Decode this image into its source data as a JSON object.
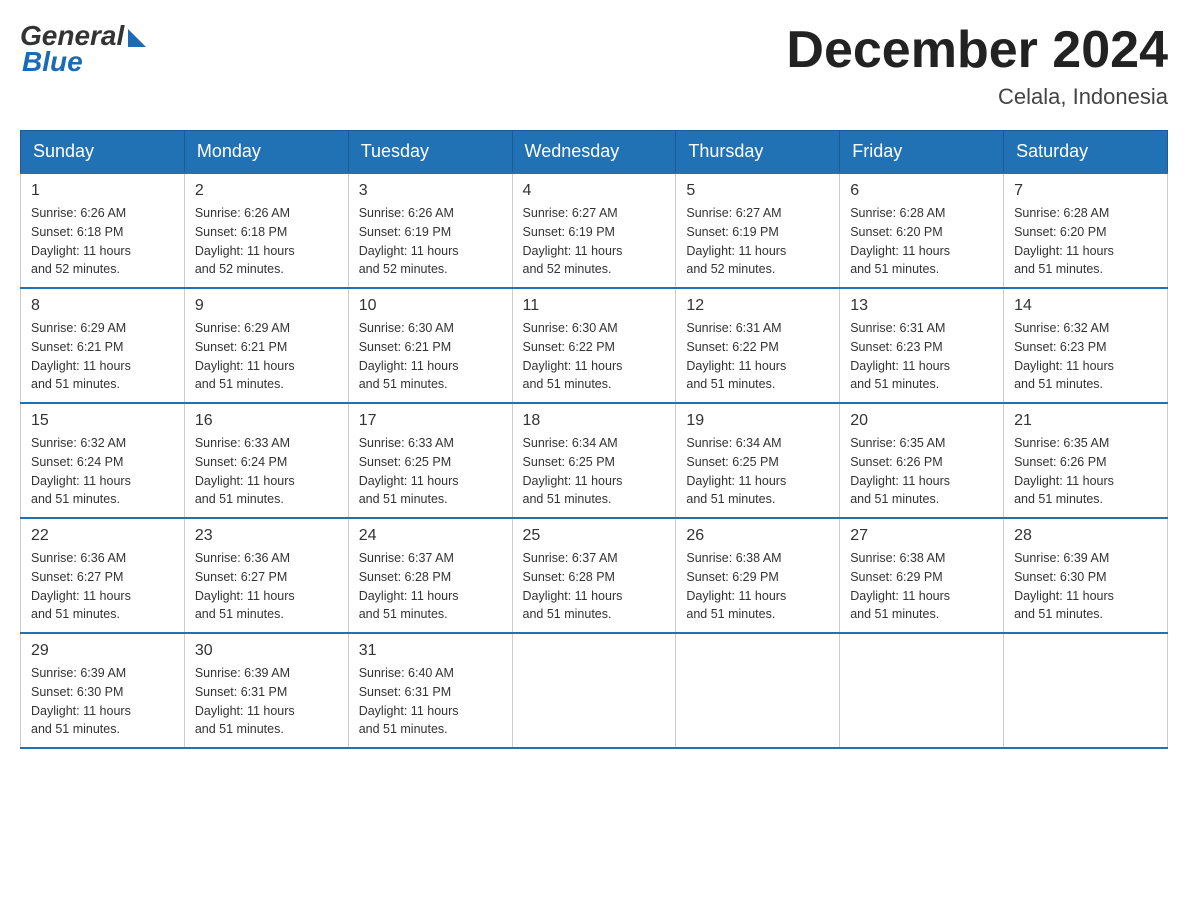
{
  "logo": {
    "general": "General",
    "blue": "Blue"
  },
  "title": {
    "month": "December 2024",
    "location": "Celala, Indonesia"
  },
  "days_header": [
    "Sunday",
    "Monday",
    "Tuesday",
    "Wednesday",
    "Thursday",
    "Friday",
    "Saturday"
  ],
  "weeks": [
    [
      {
        "day": "1",
        "sunrise": "6:26 AM",
        "sunset": "6:18 PM",
        "daylight": "11 hours and 52 minutes."
      },
      {
        "day": "2",
        "sunrise": "6:26 AM",
        "sunset": "6:18 PM",
        "daylight": "11 hours and 52 minutes."
      },
      {
        "day": "3",
        "sunrise": "6:26 AM",
        "sunset": "6:19 PM",
        "daylight": "11 hours and 52 minutes."
      },
      {
        "day": "4",
        "sunrise": "6:27 AM",
        "sunset": "6:19 PM",
        "daylight": "11 hours and 52 minutes."
      },
      {
        "day": "5",
        "sunrise": "6:27 AM",
        "sunset": "6:19 PM",
        "daylight": "11 hours and 52 minutes."
      },
      {
        "day": "6",
        "sunrise": "6:28 AM",
        "sunset": "6:20 PM",
        "daylight": "11 hours and 51 minutes."
      },
      {
        "day": "7",
        "sunrise": "6:28 AM",
        "sunset": "6:20 PM",
        "daylight": "11 hours and 51 minutes."
      }
    ],
    [
      {
        "day": "8",
        "sunrise": "6:29 AM",
        "sunset": "6:21 PM",
        "daylight": "11 hours and 51 minutes."
      },
      {
        "day": "9",
        "sunrise": "6:29 AM",
        "sunset": "6:21 PM",
        "daylight": "11 hours and 51 minutes."
      },
      {
        "day": "10",
        "sunrise": "6:30 AM",
        "sunset": "6:21 PM",
        "daylight": "11 hours and 51 minutes."
      },
      {
        "day": "11",
        "sunrise": "6:30 AM",
        "sunset": "6:22 PM",
        "daylight": "11 hours and 51 minutes."
      },
      {
        "day": "12",
        "sunrise": "6:31 AM",
        "sunset": "6:22 PM",
        "daylight": "11 hours and 51 minutes."
      },
      {
        "day": "13",
        "sunrise": "6:31 AM",
        "sunset": "6:23 PM",
        "daylight": "11 hours and 51 minutes."
      },
      {
        "day": "14",
        "sunrise": "6:32 AM",
        "sunset": "6:23 PM",
        "daylight": "11 hours and 51 minutes."
      }
    ],
    [
      {
        "day": "15",
        "sunrise": "6:32 AM",
        "sunset": "6:24 PM",
        "daylight": "11 hours and 51 minutes."
      },
      {
        "day": "16",
        "sunrise": "6:33 AM",
        "sunset": "6:24 PM",
        "daylight": "11 hours and 51 minutes."
      },
      {
        "day": "17",
        "sunrise": "6:33 AM",
        "sunset": "6:25 PM",
        "daylight": "11 hours and 51 minutes."
      },
      {
        "day": "18",
        "sunrise": "6:34 AM",
        "sunset": "6:25 PM",
        "daylight": "11 hours and 51 minutes."
      },
      {
        "day": "19",
        "sunrise": "6:34 AM",
        "sunset": "6:25 PM",
        "daylight": "11 hours and 51 minutes."
      },
      {
        "day": "20",
        "sunrise": "6:35 AM",
        "sunset": "6:26 PM",
        "daylight": "11 hours and 51 minutes."
      },
      {
        "day": "21",
        "sunrise": "6:35 AM",
        "sunset": "6:26 PM",
        "daylight": "11 hours and 51 minutes."
      }
    ],
    [
      {
        "day": "22",
        "sunrise": "6:36 AM",
        "sunset": "6:27 PM",
        "daylight": "11 hours and 51 minutes."
      },
      {
        "day": "23",
        "sunrise": "6:36 AM",
        "sunset": "6:27 PM",
        "daylight": "11 hours and 51 minutes."
      },
      {
        "day": "24",
        "sunrise": "6:37 AM",
        "sunset": "6:28 PM",
        "daylight": "11 hours and 51 minutes."
      },
      {
        "day": "25",
        "sunrise": "6:37 AM",
        "sunset": "6:28 PM",
        "daylight": "11 hours and 51 minutes."
      },
      {
        "day": "26",
        "sunrise": "6:38 AM",
        "sunset": "6:29 PM",
        "daylight": "11 hours and 51 minutes."
      },
      {
        "day": "27",
        "sunrise": "6:38 AM",
        "sunset": "6:29 PM",
        "daylight": "11 hours and 51 minutes."
      },
      {
        "day": "28",
        "sunrise": "6:39 AM",
        "sunset": "6:30 PM",
        "daylight": "11 hours and 51 minutes."
      }
    ],
    [
      {
        "day": "29",
        "sunrise": "6:39 AM",
        "sunset": "6:30 PM",
        "daylight": "11 hours and 51 minutes."
      },
      {
        "day": "30",
        "sunrise": "6:39 AM",
        "sunset": "6:31 PM",
        "daylight": "11 hours and 51 minutes."
      },
      {
        "day": "31",
        "sunrise": "6:40 AM",
        "sunset": "6:31 PM",
        "daylight": "11 hours and 51 minutes."
      },
      null,
      null,
      null,
      null
    ]
  ],
  "labels": {
    "sunrise": "Sunrise:",
    "sunset": "Sunset:",
    "daylight": "Daylight:"
  }
}
